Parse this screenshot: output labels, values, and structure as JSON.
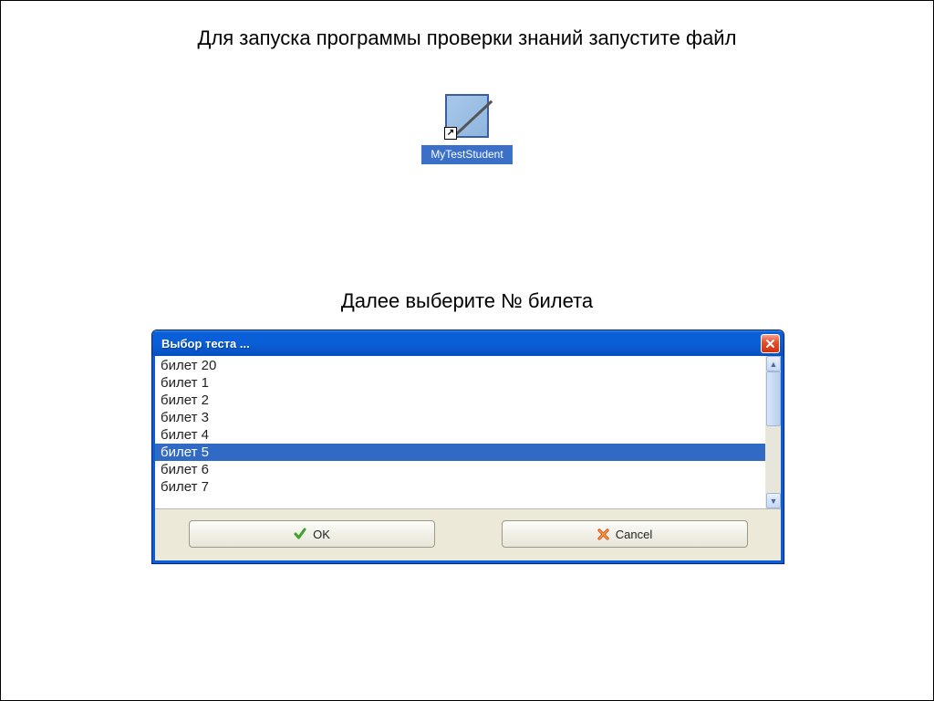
{
  "instructions": {
    "line1": "Для запуска программы проверки знаний запустите файл",
    "line2": "Далее выберите № билета"
  },
  "desktop_icon": {
    "label": "MyTestStudent"
  },
  "dialog": {
    "title": "Выбор теста ...",
    "list_items": [
      "билет 20",
      "билет 1",
      "билет 2",
      "билет 3",
      "билет 4",
      "билет 5",
      "билет 6",
      "билет 7"
    ],
    "selected_index": 5,
    "buttons": {
      "ok": "OK",
      "cancel": "Cancel"
    }
  }
}
